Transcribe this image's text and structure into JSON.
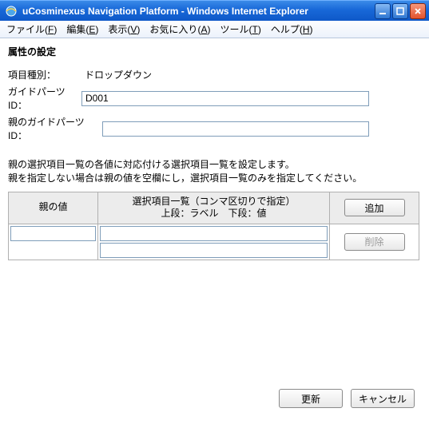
{
  "window": {
    "title": "uCosminexus Navigation Platform - Windows Internet Explorer"
  },
  "menu": {
    "file": {
      "label": "ファイル",
      "accel": "F"
    },
    "edit": {
      "label": "編集",
      "accel": "E"
    },
    "view": {
      "label": "表示",
      "accel": "V"
    },
    "fav": {
      "label": "お気に入り",
      "accel": "A"
    },
    "tools": {
      "label": "ツール",
      "accel": "T"
    },
    "help": {
      "label": "ヘルプ",
      "accel": "H"
    }
  },
  "section_title": "属性の設定",
  "form": {
    "item_type_label": "項目種別：",
    "item_type_value": "ドロップダウン",
    "guide_parts_id_label": "ガイドパーツID：",
    "guide_parts_id_value": "D001",
    "parent_guide_parts_id_label": "親のガイドパーツID：",
    "parent_guide_parts_id_value": ""
  },
  "description": {
    "line1": "親の選択項目一覧の各値に対応付ける選択項目一覧を設定します。",
    "line2": "親を指定しない場合は親の値を空欄にし，選択項目一覧のみを指定してください。"
  },
  "table": {
    "col_parent": "親の値",
    "col_options_line1": "選択項目一覧（コンマ区切りで指定）",
    "col_options_line2": "上段：ラベル　下段：値",
    "add_label": "追加",
    "delete_label": "削除",
    "rows": [
      {
        "parent": "",
        "label_row": "",
        "value_row": ""
      }
    ]
  },
  "footer": {
    "update": "更新",
    "cancel": "キャンセル"
  }
}
